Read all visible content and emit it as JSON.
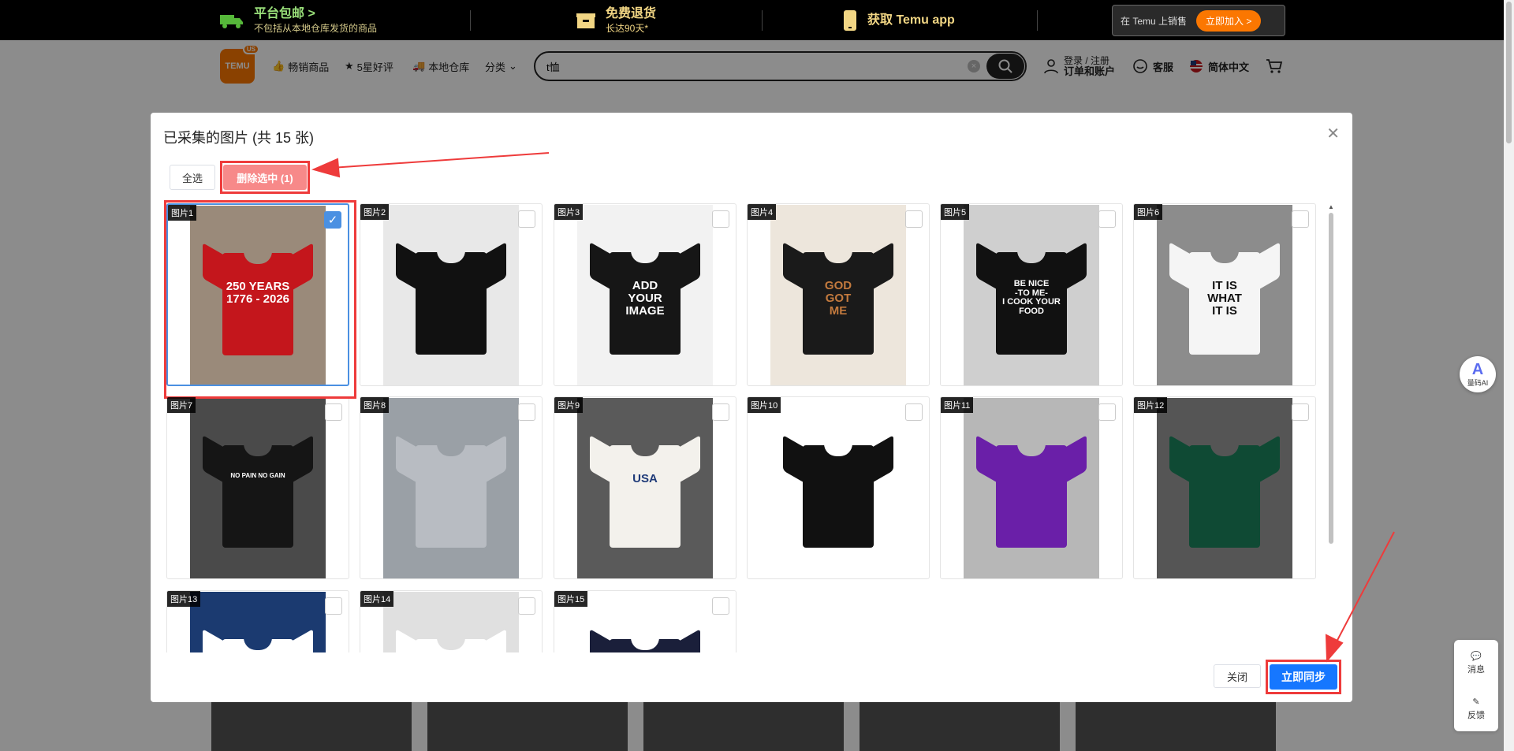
{
  "promo": {
    "free_ship_title": "平台包邮 >",
    "free_ship_sub": "不包括从本地仓库发货的商品",
    "returns_title": "免费退货",
    "returns_sub": "长达90天*",
    "app_label": "获取 Temu app",
    "sell_label": "在 Temu 上销售",
    "join_label": "立即加入 >"
  },
  "header": {
    "logo_text": "TEMU",
    "logo_badge": "US",
    "nav": [
      "畅销商品",
      "5星好评",
      "本地仓库",
      "分类"
    ],
    "search_value": "t恤",
    "login_line1": "登录 / 注册",
    "login_line2": "订单和账户",
    "service": "客服",
    "language": "简体中文"
  },
  "modal": {
    "title": "已采集的图片 (共 15 张)",
    "select_all": "全选",
    "delete_selected": "删除选中 (1)",
    "close": "关闭",
    "sync": "立即同步",
    "images": [
      {
        "label": "图片1",
        "selected": true,
        "print": "250 YEARS\n1776 - 2026",
        "shirt_color": "#c4161c",
        "print_color": "#ffffff",
        "bg": "#9a8a7a"
      },
      {
        "label": "图片2",
        "selected": false,
        "print": "",
        "shirt_color": "#111111",
        "print_color": "#ffffff",
        "bg": "#e8e8e8"
      },
      {
        "label": "图片3",
        "selected": false,
        "print": "ADD\nYOUR\nIMAGE",
        "shirt_color": "#161616",
        "print_color": "#ffffff",
        "bg": "#f2f2f2"
      },
      {
        "label": "图片4",
        "selected": false,
        "print": "GOD\nGOT\nME",
        "shirt_color": "#1a1a1a",
        "print_color": "#c37a3e",
        "bg": "#ede6dc"
      },
      {
        "label": "图片5",
        "selected": false,
        "print": "BE NICE\n-TO ME-\nI COOK YOUR\nFOOD",
        "shirt_color": "#111111",
        "print_color": "#ffffff",
        "bg": "#cfcfcf"
      },
      {
        "label": "图片6",
        "selected": false,
        "print": "IT IS\nWHAT\nIT IS",
        "shirt_color": "#f5f5f5",
        "print_color": "#111111",
        "bg": "#8c8c8c"
      },
      {
        "label": "图片7",
        "selected": false,
        "print": "NO PAIN NO GAIN",
        "shirt_color": "#151515",
        "print_color": "#ffffff",
        "bg": "#4a4a4a"
      },
      {
        "label": "图片8",
        "selected": false,
        "print": "",
        "shirt_color": "#b8bcc2",
        "print_color": "#ffffff",
        "bg": "#9aa0a6"
      },
      {
        "label": "图片9",
        "selected": false,
        "print": "USA",
        "shirt_color": "#f3f1ec",
        "print_color": "#1e3a78",
        "bg": "#5a5a5a"
      },
      {
        "label": "图片10",
        "selected": false,
        "print": "",
        "shirt_color": "#111111",
        "print_color": "#ffffff",
        "bg": "#ffffff"
      },
      {
        "label": "图片11",
        "selected": false,
        "print": "",
        "shirt_color": "#6a1fa8",
        "print_color": "#ffffff",
        "bg": "#b7b7b7"
      },
      {
        "label": "图片12",
        "selected": false,
        "print": "",
        "shirt_color": "#0f4a34",
        "print_color": "#ffffff",
        "bg": "#555555"
      },
      {
        "label": "图片13",
        "selected": false,
        "print": "",
        "shirt_color": "#ffffff",
        "print_color": "#2a7bd1",
        "bg": "#1b3a70"
      },
      {
        "label": "图片14",
        "selected": false,
        "print": "",
        "shirt_color": "#ffffff",
        "print_color": "#333333",
        "bg": "#e0e0e0"
      },
      {
        "label": "图片15",
        "selected": false,
        "print": "",
        "shirt_color": "#1a1f3a",
        "print_color": "#ffffff",
        "bg": "#ffffff"
      }
    ]
  },
  "side_tools": {
    "ai_label": "量码AI",
    "message": "消息",
    "feedback": "反馈"
  }
}
